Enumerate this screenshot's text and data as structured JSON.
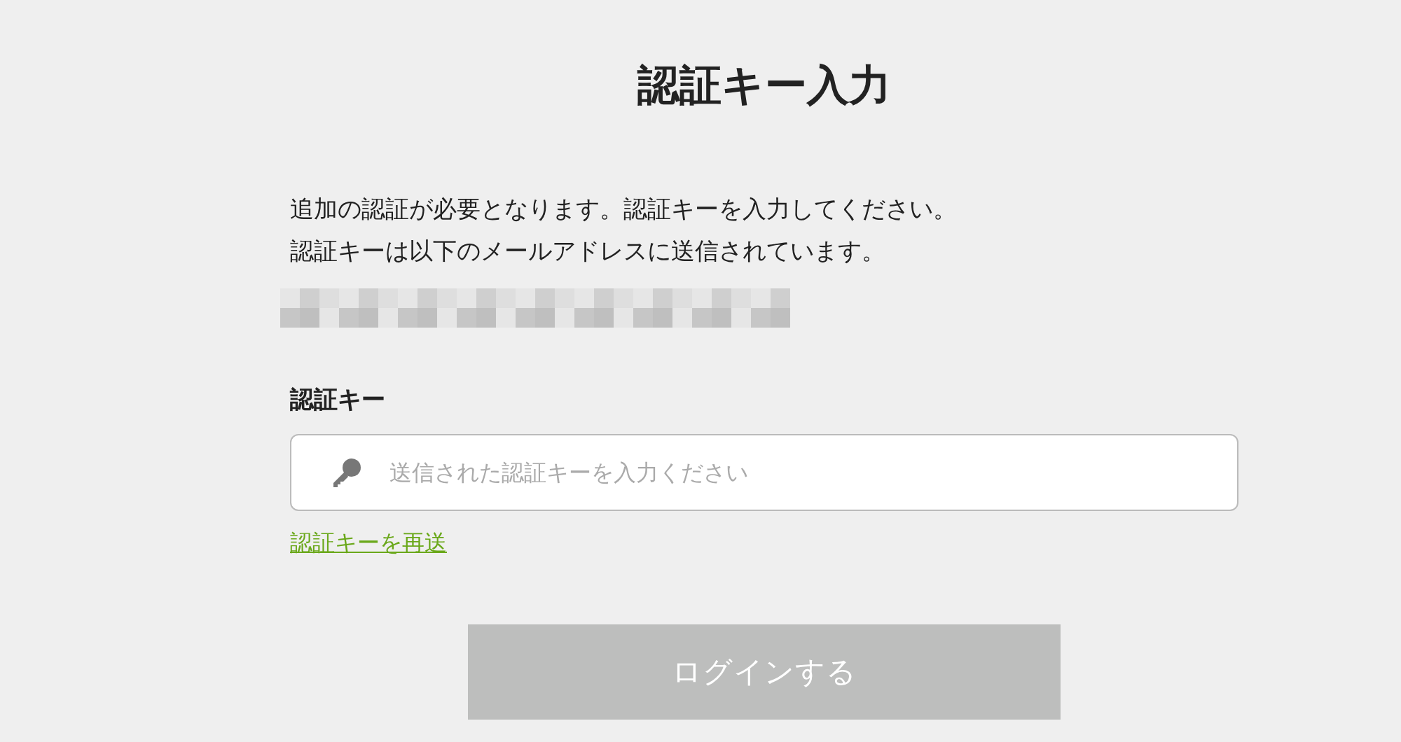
{
  "title": "認証キー入力",
  "message_lines": [
    "追加の認証が必要となります。認証キーを入力してください。",
    "認証キーは以下のメールアドレスに送信されています。"
  ],
  "email": {
    "kind": "redacted"
  },
  "field": {
    "label": "認証キー",
    "placeholder": "送信された認証キーを入力ください"
  },
  "resend_link": "認証キーを再送",
  "login_button": {
    "label": "ログインする",
    "disabled": true
  }
}
